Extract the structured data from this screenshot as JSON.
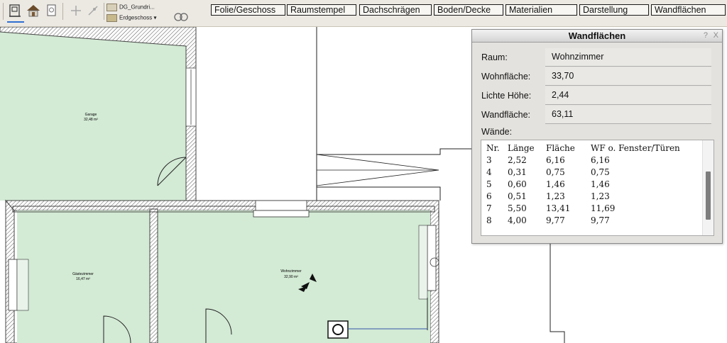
{
  "toolbar": {
    "floor_selector": {
      "view": "DG_Grundri...",
      "floor": "Erdgeschoss"
    },
    "menu": [
      "Folie/Geschoss",
      "Raumstempel",
      "Dachschrägen",
      "Boden/Decke",
      "Materialien",
      "Darstellung",
      "Wandflächen"
    ],
    "icons": [
      "door-window-icon",
      "house-3d-icon",
      "document-icon",
      "move-icon",
      "snap-icon",
      "render-icon"
    ]
  },
  "plan": {
    "rooms": [
      {
        "name": "Garage",
        "area": "32,48 m²"
      },
      {
        "name": "Gästezimmer",
        "area": "16,47 m²"
      },
      {
        "name": "Wohnzimmer",
        "area": "32,90 m²"
      }
    ],
    "colors": {
      "room_fill": "#d3ead5",
      "wall": "#555555"
    }
  },
  "dialog": {
    "title": "Wandflächen",
    "help_button": "?",
    "close_button": "X",
    "fields": [
      {
        "label": "Raum:",
        "value": "Wohnzimmer"
      },
      {
        "label": "Wohnfläche:",
        "value": "33,70"
      },
      {
        "label": "Lichte Höhe:",
        "value": "2,44"
      },
      {
        "label": "Wandfläche:",
        "value": "63,11"
      }
    ],
    "walls_label": "Wände:",
    "walls_table": {
      "headers": [
        "Nr.",
        "Länge",
        "Fläche",
        "WF o. Fenster/Türen"
      ],
      "rows": [
        [
          "3",
          "2,52",
          "6,16",
          "6,16"
        ],
        [
          "4",
          "0,31",
          "0,75",
          "0,75"
        ],
        [
          "5",
          "0,60",
          "1,46",
          "1,46"
        ],
        [
          "6",
          "0,51",
          "1,23",
          "1,23"
        ],
        [
          "7",
          "5,50",
          "13,41",
          "11,69"
        ],
        [
          "8",
          "4,00",
          "9,77",
          "9,77"
        ]
      ]
    }
  }
}
